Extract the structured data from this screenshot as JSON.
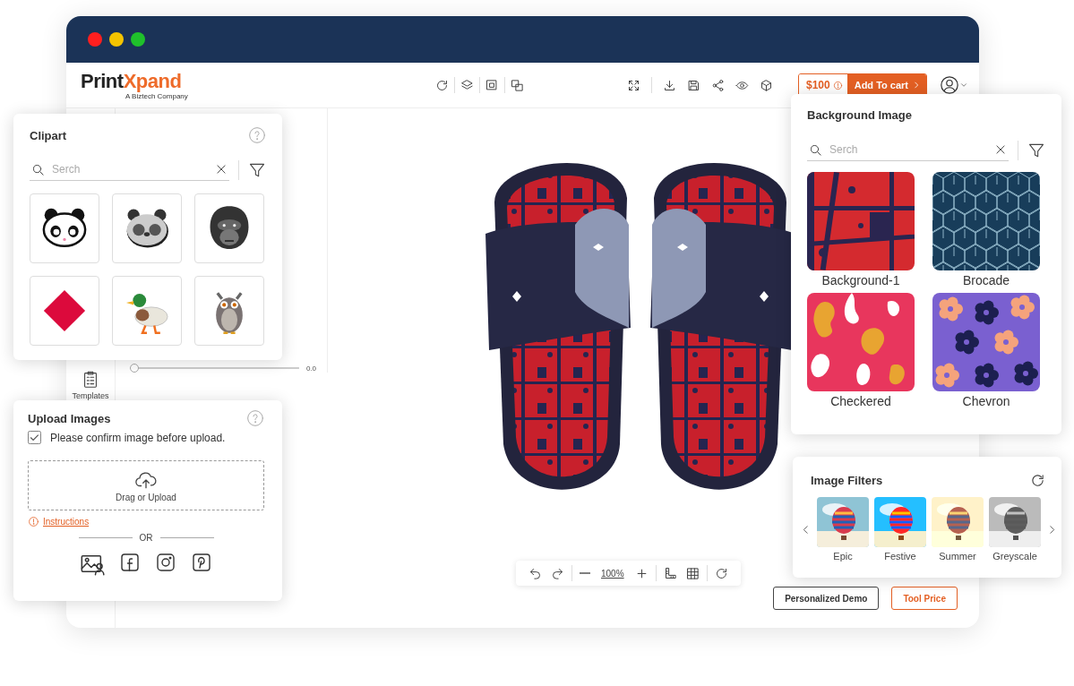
{
  "window": {
    "controls": [
      {
        "color": "#ff1f1f"
      },
      {
        "color": "#f5c400"
      },
      {
        "color": "#1fc12b"
      }
    ]
  },
  "header": {
    "logo": {
      "part_1": "Print",
      "part_2": "X",
      "part_3": "pand",
      "tagline": "A Biztech Company"
    },
    "price": "$100",
    "cart": "Add To cart"
  },
  "sidebar": {
    "items": [
      {
        "label": "Templates"
      }
    ]
  },
  "properties": {
    "slider": {
      "level": 0,
      "reading": "0.0"
    }
  },
  "canvas_toolbar": {
    "zoom": "100%"
  },
  "footer_buttons": [
    {
      "label": "Personalized Demo",
      "kind": "outline"
    },
    {
      "label": "Tool Price",
      "kind": "accent"
    }
  ],
  "clipart": {
    "title": "Clipart",
    "search": {
      "placeholder": "Serch"
    },
    "items": [
      {
        "kind": "panda-outline"
      },
      {
        "kind": "panda-grey"
      },
      {
        "kind": "gorilla"
      },
      {
        "kind": "diamond"
      },
      {
        "kind": "duck"
      },
      {
        "kind": "owl"
      }
    ]
  },
  "upload": {
    "title": "Upload Images",
    "confirm": {
      "label": "Please confirm image before upload.",
      "checked": true
    },
    "drop_label": "Drag or Upload",
    "instructions": "Instructions",
    "divider": "OR"
  },
  "background_image": {
    "title": "Background Image",
    "search": {
      "placeholder": "Serch"
    },
    "items": [
      {
        "label": "Background-1",
        "kind": "grunge"
      },
      {
        "label": "Brocade",
        "kind": "geometric"
      },
      {
        "label": "Checkered",
        "kind": "blobs"
      },
      {
        "label": "Chevron",
        "kind": "flowers"
      }
    ]
  },
  "image_filters": {
    "title": "Image Filters",
    "items": [
      {
        "label": "Epic",
        "kind": "epic"
      },
      {
        "label": "Festive",
        "kind": "festive"
      },
      {
        "label": "Summer",
        "kind": "summer"
      },
      {
        "label": "Greyscale",
        "kind": "greyscale"
      }
    ]
  }
}
